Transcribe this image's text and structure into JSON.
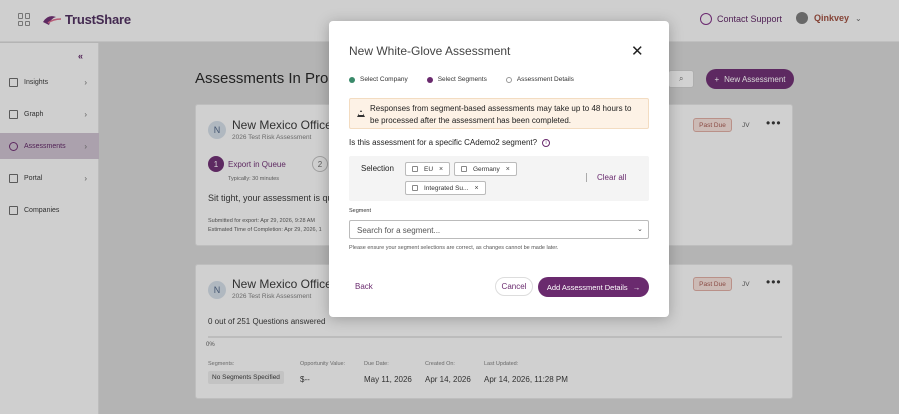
{
  "app": {
    "name": "TrustShare",
    "brand": "Qinkvey"
  },
  "header": {
    "contact_support": "Contact Support"
  },
  "sidebar": {
    "collapse_glyph": "«",
    "items": [
      {
        "label": "Insights",
        "icon": "lightbulb-icon"
      },
      {
        "label": "Graph",
        "icon": "chart-icon"
      },
      {
        "label": "Assessments",
        "icon": "gear-icon"
      },
      {
        "label": "Portal",
        "icon": "portal-icon"
      },
      {
        "label": "Companies",
        "icon": "building-icon"
      }
    ]
  },
  "main": {
    "title": "Assessments In Progress",
    "new_button": "New Assessment",
    "cards": [
      {
        "initial": "N",
        "title": "New Mexico Office of",
        "subtitle": "2026 Test Risk Assessment",
        "badge": "Past Due",
        "owner": "JV",
        "step1_num": "1",
        "step1_label": "Export in Queue",
        "step2_num": "2",
        "typical": "Typically: 30 minutes",
        "message": "Sit tight, your assessment is que",
        "submitted": "Submitted for export: Apr 29, 2026, 9:28 AM",
        "estimated": "Estimated Time of Completion: Apr 29, 2026, 1"
      },
      {
        "initial": "N",
        "title": "New Mexico Office of",
        "subtitle": "2026 Test Risk Assessment",
        "badge": "Past Due",
        "owner": "JV",
        "questions": "0 out of 251 Questions answered",
        "progress": 0,
        "progress_label": "0%",
        "segments_label": "Segments:",
        "segments_value": "No Segments Specified",
        "opportunity_label": "Opportunity Value:",
        "opportunity_value": "$--",
        "due_label": "Due Date:",
        "due_value": "May 11, 2026",
        "created_label": "Created On:",
        "created_value": "Apr 14, 2026",
        "updated_label": "Last Updated:",
        "updated_value": "Apr 14, 2026, 11:28 PM"
      }
    ]
  },
  "modal": {
    "title": "New White-Glove Assessment",
    "close_glyph": "✕",
    "steps": [
      {
        "label": "Select Company",
        "state": "done"
      },
      {
        "label": "Select Segments",
        "state": "current"
      },
      {
        "label": "Assessment Details",
        "state": "todo"
      }
    ],
    "warning": "Responses from segment-based assessments may take up to 48 hours to be processed after the assessment has been completed.",
    "question": "Is this assessment for a specific CAdemo2 segment?",
    "selection_label": "Selection",
    "tags": [
      "EU",
      "Germany",
      "Integrated Su..."
    ],
    "tag_remove_glyph": "×",
    "clear_all": "Clear all",
    "segment_label": "Segment",
    "segment_placeholder": "Search for a segment...",
    "note": "Please ensure your segment selections are correct, as changes cannot be made later.",
    "back": "Back",
    "cancel": "Cancel",
    "add": "Add Assessment Details",
    "add_arrow": "→"
  },
  "colors": {
    "primary": "#6a2a6e",
    "step_done": "#3a8a6a",
    "warning_bg": "#fdf2e6"
  }
}
